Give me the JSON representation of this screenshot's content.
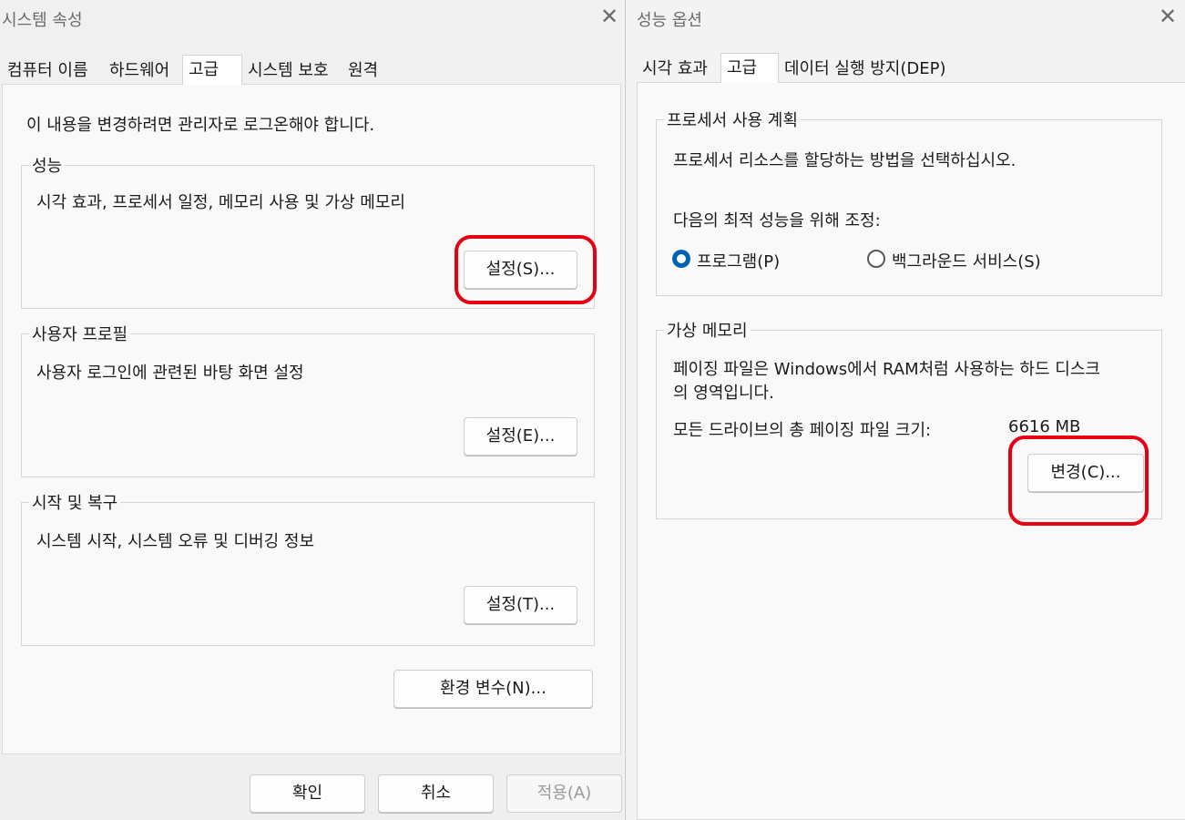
{
  "system_properties": {
    "title": "시스템 속성",
    "close_glyph": "✕",
    "tabs": [
      "컴퓨터 이름",
      "하드웨어",
      "고급",
      "시스템 보호",
      "원격"
    ],
    "active_tab": "고급",
    "admin_notice": "이 내용을 변경하려면 관리자로 로그온해야 합니다.",
    "performance": {
      "legend": "성능",
      "description": "시각 효과, 프로세서 일정, 메모리 사용 및 가상 메모리",
      "button": "설정(S)..."
    },
    "user_profile": {
      "legend": "사용자 프로필",
      "description": "사용자 로그인에 관련된 바탕 화면 설정",
      "button": "설정(E)..."
    },
    "startup_recovery": {
      "legend": "시작 및 복구",
      "description": "시스템 시작, 시스템 오류 및 디버깅 정보",
      "button": "설정(T)..."
    },
    "env_button": "환경 변수(N)...",
    "footer": {
      "ok": "확인",
      "cancel": "취소",
      "apply": "적용(A)"
    }
  },
  "performance_options": {
    "title": "성능 옵션",
    "close_glyph": "✕",
    "tabs": [
      "시각 효과",
      "고급",
      "데이터 실행 방지(DEP)"
    ],
    "active_tab": "고급",
    "processor": {
      "legend": "프로세서 사용 계획",
      "description": "프로세서 리소스를 할당하는 방법을 선택하십시오.",
      "adjust_label": "다음의 최적 성능을 위해 조정:",
      "option_programs": "프로그램(P)",
      "option_background": "백그라운드 서비스(S)",
      "selected": "프로그램(P)"
    },
    "virtual_memory": {
      "legend": "가상 메모리",
      "description_line1": "페이징 파일은 Windows에서 RAM처럼 사용하는 하드 디스크",
      "description_line2": "의 영역입니다.",
      "total_label": "모든 드라이브의 총 페이징 파일 크기:",
      "total_value": "6616 MB",
      "button": "변경(C)..."
    }
  },
  "colors": {
    "highlight": "#e60012",
    "radio_selected": "#0063b1"
  }
}
